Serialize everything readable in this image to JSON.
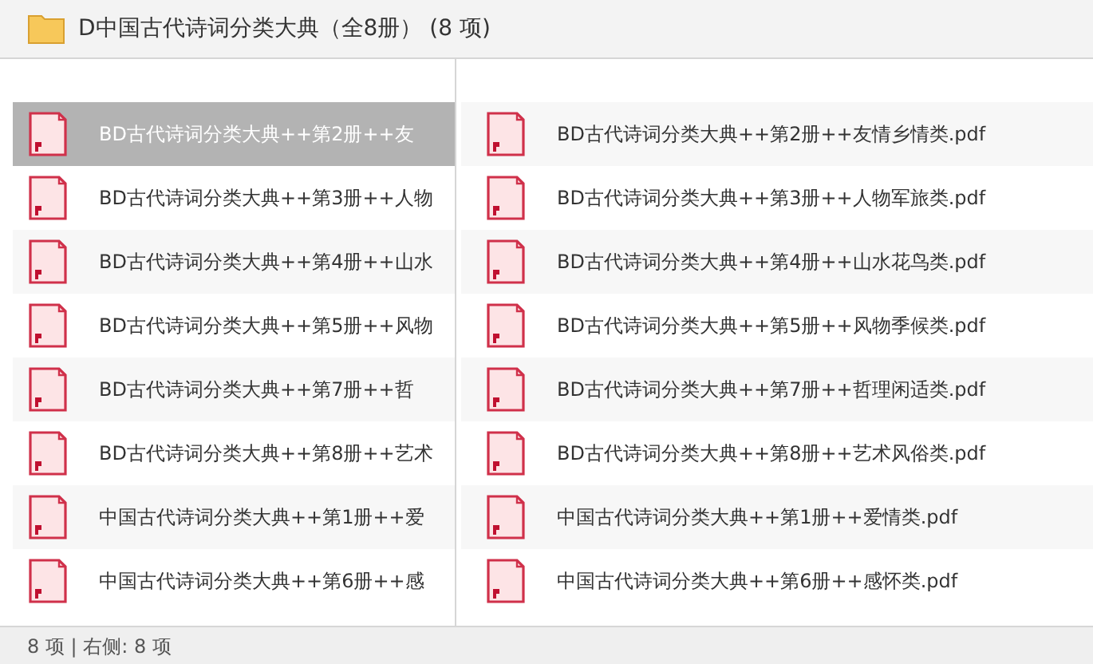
{
  "header": {
    "title": "D中国古代诗词分类大典（全8册） (8 项)"
  },
  "left_pane": {
    "items": [
      {
        "name": "BD古代诗词分类大典++第2册++友",
        "selected": true
      },
      {
        "name": "BD古代诗词分类大典++第3册++人物",
        "selected": false
      },
      {
        "name": "BD古代诗词分类大典++第4册++山水",
        "selected": false
      },
      {
        "name": "BD古代诗词分类大典++第5册++风物",
        "selected": false
      },
      {
        "name": "BD古代诗词分类大典++第7册++哲",
        "selected": false
      },
      {
        "name": "BD古代诗词分类大典++第8册++艺术",
        "selected": false
      },
      {
        "name": "中国古代诗词分类大典++第1册++爱",
        "selected": false
      },
      {
        "name": "中国古代诗词分类大典++第6册++感",
        "selected": false
      }
    ]
  },
  "right_pane": {
    "items": [
      {
        "name": "BD古代诗词分类大典++第2册++友情乡情类.pdf",
        "selected": false
      },
      {
        "name": "BD古代诗词分类大典++第3册++人物军旅类.pdf",
        "selected": false
      },
      {
        "name": "BD古代诗词分类大典++第4册++山水花鸟类.pdf",
        "selected": false
      },
      {
        "name": "BD古代诗词分类大典++第5册++风物季候类.pdf",
        "selected": false
      },
      {
        "name": "BD古代诗词分类大典++第7册++哲理闲适类.pdf",
        "selected": false
      },
      {
        "name": "BD古代诗词分类大典++第8册++艺术风俗类.pdf",
        "selected": false
      },
      {
        "name": "中国古代诗词分类大典++第1册++爱情类.pdf",
        "selected": false
      },
      {
        "name": "中国古代诗词分类大典++第6册++感怀类.pdf",
        "selected": false
      }
    ]
  },
  "status_bar": {
    "text": "8 项 | 右侧: 8 项"
  }
}
